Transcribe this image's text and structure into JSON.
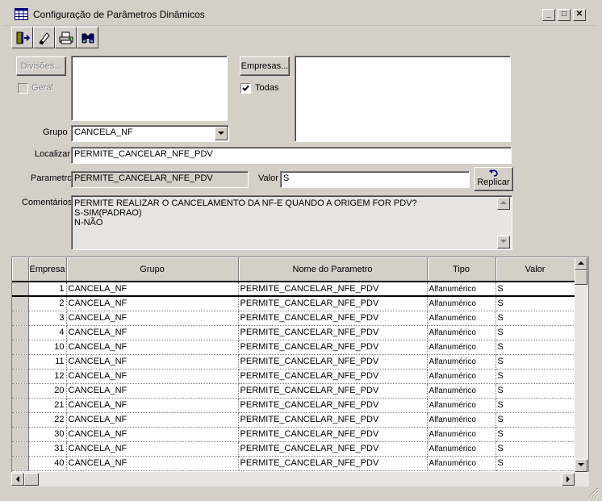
{
  "window": {
    "title": "Configuração de Parâmetros Dinâmicos",
    "buttons": {
      "minimize": "_",
      "maximize": "□",
      "close": "✕"
    }
  },
  "toolbar": {
    "icons": [
      "exit-door-icon",
      "eraser-icon",
      "print-icon",
      "binoculars-icon"
    ]
  },
  "form": {
    "divisoes_label": "Divisões...",
    "geral_label": "Geral",
    "empresas_label": "Empresas...",
    "todas_label": "Todas",
    "todas_checked": true,
    "grupo_label": "Grupo",
    "grupo_value": "CANCELA_NF",
    "localizar_label": "Localizar",
    "localizar_value": "PERMITE_CANCELAR_NFE_PDV",
    "parametro_label": "Parametro",
    "parametro_value": "PERMITE_CANCELAR_NFE_PDV",
    "valor_label": "Valor",
    "valor_value": "S",
    "replicar_label": "Replicar",
    "comentarios_label": "Comentários",
    "comentarios_lines": [
      "PERMITE REALIZAR O CANCELAMENTO DA NF-E QUANDO A ORIGEM FOR PDV?",
      "S-SIM(PADRAO)",
      "N-NÃO"
    ]
  },
  "grid": {
    "headers": [
      "Empresa",
      "Grupo",
      "Nome do Parametro",
      "Tipo",
      "Valor"
    ],
    "rows": [
      {
        "empresa": "1",
        "grupo": "CANCELA_NF",
        "nome": "PERMITE_CANCELAR_NFE_PDV",
        "tipo": "Alfanumérico",
        "valor": "S"
      },
      {
        "empresa": "2",
        "grupo": "CANCELA_NF",
        "nome": "PERMITE_CANCELAR_NFE_PDV",
        "tipo": "Alfanumérico",
        "valor": "S"
      },
      {
        "empresa": "3",
        "grupo": "CANCELA_NF",
        "nome": "PERMITE_CANCELAR_NFE_PDV",
        "tipo": "Alfanumérico",
        "valor": "S"
      },
      {
        "empresa": "4",
        "grupo": "CANCELA_NF",
        "nome": "PERMITE_CANCELAR_NFE_PDV",
        "tipo": "Alfanumérico",
        "valor": "S"
      },
      {
        "empresa": "10",
        "grupo": "CANCELA_NF",
        "nome": "PERMITE_CANCELAR_NFE_PDV",
        "tipo": "Alfanumérico",
        "valor": "S"
      },
      {
        "empresa": "11",
        "grupo": "CANCELA_NF",
        "nome": "PERMITE_CANCELAR_NFE_PDV",
        "tipo": "Alfanumérico",
        "valor": "S"
      },
      {
        "empresa": "12",
        "grupo": "CANCELA_NF",
        "nome": "PERMITE_CANCELAR_NFE_PDV",
        "tipo": "Alfanumérico",
        "valor": "S"
      },
      {
        "empresa": "20",
        "grupo": "CANCELA_NF",
        "nome": "PERMITE_CANCELAR_NFE_PDV",
        "tipo": "Alfanumérico",
        "valor": "S"
      },
      {
        "empresa": "21",
        "grupo": "CANCELA_NF",
        "nome": "PERMITE_CANCELAR_NFE_PDV",
        "tipo": "Alfanumérico",
        "valor": "S"
      },
      {
        "empresa": "22",
        "grupo": "CANCELA_NF",
        "nome": "PERMITE_CANCELAR_NFE_PDV",
        "tipo": "Alfanumérico",
        "valor": "S"
      },
      {
        "empresa": "30",
        "grupo": "CANCELA_NF",
        "nome": "PERMITE_CANCELAR_NFE_PDV",
        "tipo": "Alfanumérico",
        "valor": "S"
      },
      {
        "empresa": "31",
        "grupo": "CANCELA_NF",
        "nome": "PERMITE_CANCELAR_NFE_PDV",
        "tipo": "Alfanumérico",
        "valor": "S"
      },
      {
        "empresa": "40",
        "grupo": "CANCELA_NF",
        "nome": "PERMITE_CANCELAR_NFE_PDV",
        "tipo": "Alfanumérico",
        "valor": "S"
      }
    ],
    "selected_index": 0
  }
}
